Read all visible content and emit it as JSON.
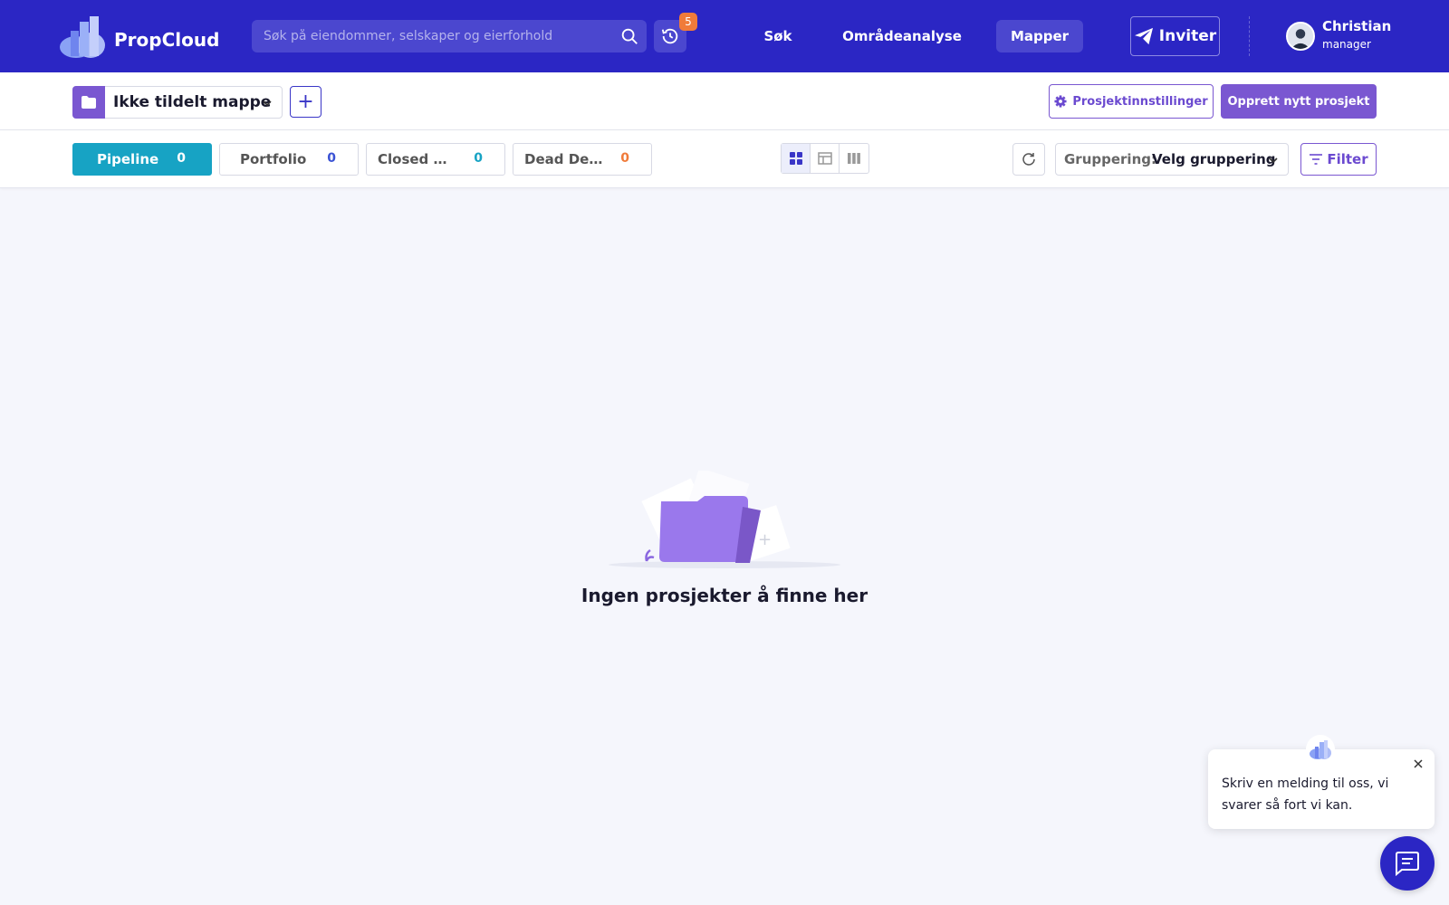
{
  "app": {
    "name": "PropCloud",
    "accent_color": "#2b26c4",
    "primary_purple": "#7a57d1"
  },
  "header": {
    "search": {
      "placeholder": "Søk på eiendommer, selskaper og eierforhold",
      "value": "",
      "icon": "search-icon"
    },
    "history": {
      "icon": "history-icon",
      "badge_count": "5"
    },
    "nav": [
      {
        "label": "Søk",
        "active": false
      },
      {
        "label": "Områdeanalyse",
        "active": false
      },
      {
        "label": "Mapper",
        "active": true
      }
    ],
    "invite_label": "Inviter",
    "user": {
      "name": "Christian",
      "role": "manager"
    }
  },
  "folder_bar": {
    "selected_folder": "Ikke tildelt mappe",
    "add_icon": "plus-icon",
    "settings_label": "Prosjektinnstillinger",
    "create_label": "Opprett nytt prosjekt"
  },
  "tabs": [
    {
      "label": "Pipeline",
      "count": "0",
      "active": true,
      "color": "#17a3c4"
    },
    {
      "label": "Portfolio",
      "count": "0",
      "active": false,
      "color": "#3a52d4"
    },
    {
      "label": "Closed Deals",
      "count": "0",
      "active": false,
      "color": "#17a3c4"
    },
    {
      "label": "Dead Deals",
      "count": "0",
      "active": false,
      "color": "#f07b3a"
    }
  ],
  "toolbar": {
    "views": [
      "grid-view-icon",
      "table-view-icon",
      "board-view-icon"
    ],
    "active_view": "grid-view-icon",
    "grouping_label": "Gruppering:",
    "grouping_value": "Velg gruppering",
    "filter_label": "Filter"
  },
  "empty_state": {
    "message": "Ingen prosjekter å finne her"
  },
  "chat": {
    "message": "Skriv en melding til oss, vi svarer så fort vi kan."
  }
}
